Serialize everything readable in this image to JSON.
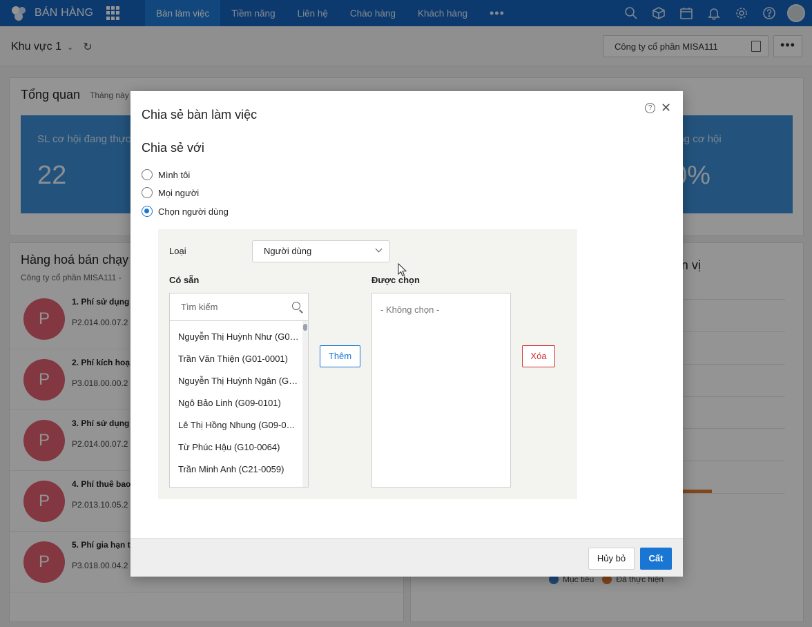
{
  "app": {
    "brand": "BÁN HÀNG",
    "nav": [
      "Bàn làm việc",
      "Tiềm năng",
      "Liên hệ",
      "Chào hàng",
      "Khách hàng"
    ],
    "nav_more": "•••",
    "colors": {
      "primary": "#1565c0",
      "active_tab": "#1e7ad6",
      "accent": "#1976d2",
      "danger": "#d32f2f"
    },
    "icons": [
      "search-icon",
      "box-icon",
      "calendar-icon",
      "bell-icon",
      "gear-icon",
      "help-icon",
      "user-avatar"
    ]
  },
  "subheader": {
    "region": "Khu vực 1",
    "company": "Công ty cổ phần MISA111",
    "more": "•••"
  },
  "background": {
    "overview_title": "Tổng quan",
    "overview_period": "Tháng này",
    "tile1_label": "SL cơ hội đang thực",
    "tile1_value": "22",
    "tile2_label": "ắng cơ hội",
    "tile2_value": "0%",
    "bestseller_title": "Hàng hoá bán chạy",
    "bestseller_sub": "Công ty cổ phần MISA111 -",
    "items": [
      {
        "avatar": "P",
        "name": "1. Phí sử dụng",
        "code": "P2.014.00.07.2"
      },
      {
        "avatar": "P",
        "name": "2. Phí kích hoạ",
        "code": "P3.018.00.00.2"
      },
      {
        "avatar": "P",
        "name": "3. Phí sử dụng",
        "code": "P2.014.00.07.2"
      },
      {
        "avatar": "P",
        "name": "4. Phí thuê bao",
        "code": "P2.013.10.05.2"
      },
      {
        "avatar": "P",
        "name": "5. Phí gia hạn t",
        "code": "P3.018.00.04.2"
      }
    ],
    "right_title": "ơn vị",
    "legend": [
      "Mục tiêu",
      "Đã thực hiện"
    ]
  },
  "modal": {
    "title": "Chia sẻ bàn làm việc",
    "help": "?",
    "close": "✕",
    "share_with": "Chia sẻ với",
    "options": [
      "Mình tôi",
      "Mọi người",
      "Chọn người dùng"
    ],
    "selected_option": 2,
    "type_label": "Loại",
    "type_value": "Người dùng",
    "available_label": "Có sẵn",
    "selected_label": "Được chọn",
    "search_placeholder": "Tìm kiếm",
    "users": [
      "Nguyễn Thị Huỳnh Như (G0…",
      "Trần Văn Thiện (G01-0001)",
      "Nguyễn Thị Huỳnh Ngân (G…",
      "Ngô Bảo Linh (G09-0101)",
      "Lê Thị Hồng Nhung (G09-0…",
      "Từ Phúc Hậu (G10-0064)",
      "Trần Minh Anh (C21-0059)"
    ],
    "empty_selection": "- Không chọn -",
    "add": "Thêm",
    "remove": "Xóa",
    "cancel": "Hủy bỏ",
    "save": "Cất"
  }
}
